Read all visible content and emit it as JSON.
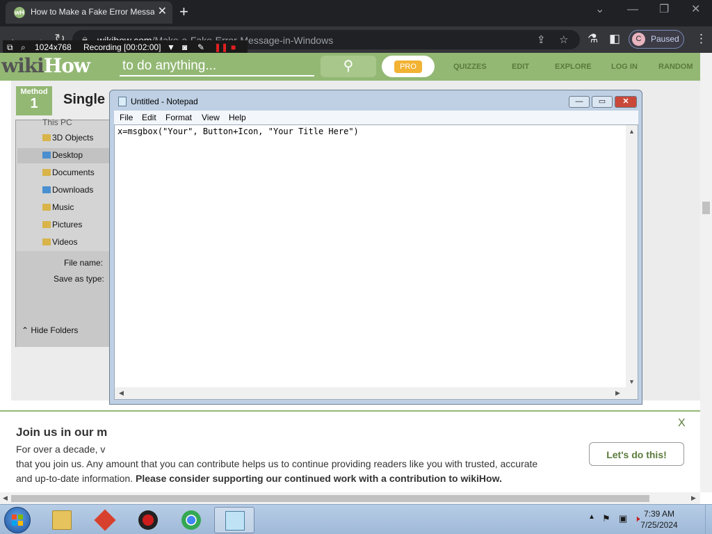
{
  "browser": {
    "tab_title": "How to Make a Fake Error Message in Windows",
    "favicon_text": "wH",
    "tab_close": "✕",
    "new_tab": "+",
    "window_min": "—",
    "window_restore": "❐",
    "window_close": "✕",
    "url_host": "wikihow.com",
    "url_path": "/Make-a-Fake-Error-Message-in-Windows",
    "profile_initial": "C",
    "profile_status": "Paused"
  },
  "recorder": {
    "resolution": "1024x768",
    "status": "Recording [00:02:00]"
  },
  "wikihow": {
    "logo_wiki": "wiki",
    "logo_how": "How",
    "search_placeholder": "to do anything...",
    "pro_label": "PRO",
    "nav": [
      "QUIZZES",
      "EDIT",
      "EXPLORE",
      "LOG IN",
      "RANDOM"
    ],
    "method_label": "Method",
    "method_number": "1",
    "method_title": "Single",
    "explorer": {
      "top_item": "This PC",
      "items": [
        "3D Objects",
        "Desktop",
        "Documents",
        "Downloads",
        "Music",
        "Pictures",
        "Videos"
      ],
      "file_name_label": "File name:",
      "save_as_label": "Save as type:",
      "hide_folders": "Hide Folders"
    },
    "banner": {
      "title": "Join us in our m",
      "line1": "For over a decade, v",
      "line2": "that you join us. Any amount that you can contribute helps us to continue providing readers like you with trusted, accurate",
      "line3_plain": "and up-to-date information.",
      "line3_bold": "Please consider supporting our continued work with a contribution to wikiHow.",
      "close": "X",
      "button": "Let's do this!"
    }
  },
  "notepad": {
    "title": "Untitled - Notepad",
    "menus": [
      "File",
      "Edit",
      "Format",
      "View",
      "Help"
    ],
    "content": "x=msgbox(\"Your\", Button+Icon, \"Your Title Here\")"
  },
  "taskbar": {
    "time": "7:39 AM",
    "date": "7/25/2024"
  },
  "colors": {
    "wikihow_green": "#93b874",
    "pro_orange": "#f2b233",
    "chrome_dark": "#202124"
  }
}
